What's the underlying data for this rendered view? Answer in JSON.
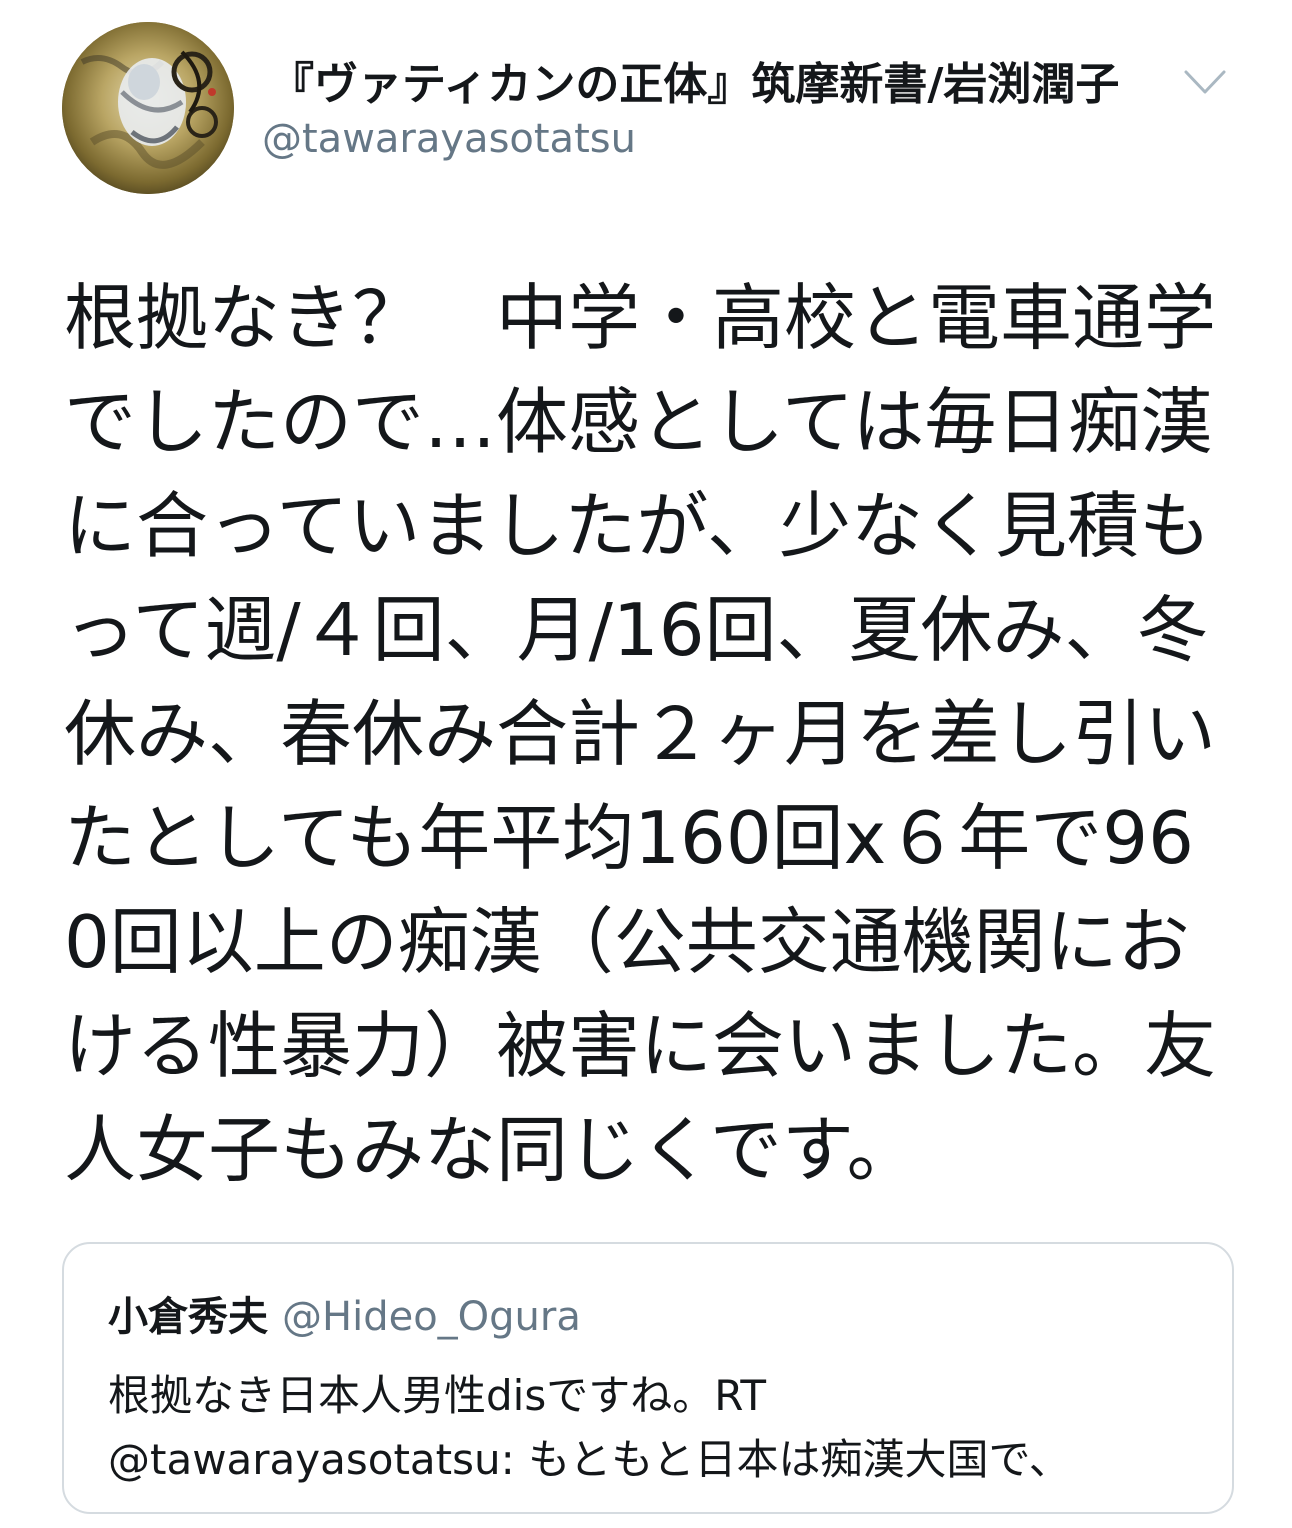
{
  "author": {
    "display_name": "『ヴァティカンの正体』筑摩新書/岩渕潤子",
    "handle": "@tawarayasotatsu",
    "avatar_icon": "painting-avatar-icon"
  },
  "menu": {
    "icon": "chevron-down-icon"
  },
  "tweet": {
    "text": "根拠なき？　中学・高校と電車通学でしたので…体感としては毎日痴漢に合っていましたが、少なく見積もって週/４回、月/16回、夏休み、冬休み、春休み合計２ヶ月を差し引いたとしても年平均160回x６年で960回以上の痴漢（公共交通機関における性暴力）被害に会いました。友人女子もみな同じくです。"
  },
  "quoted_tweet": {
    "name": "小倉秀夫",
    "handle": "@Hideo_Ogura",
    "text_line1": "根拠なき日本人男性disですね。RT",
    "text_line2": "@tawarayasotatsu: もともと日本は痴漢大国で、"
  },
  "colors": {
    "text_primary": "#14171a",
    "text_secondary": "#657786",
    "border": "#d5dbe0",
    "background": "#ffffff"
  }
}
